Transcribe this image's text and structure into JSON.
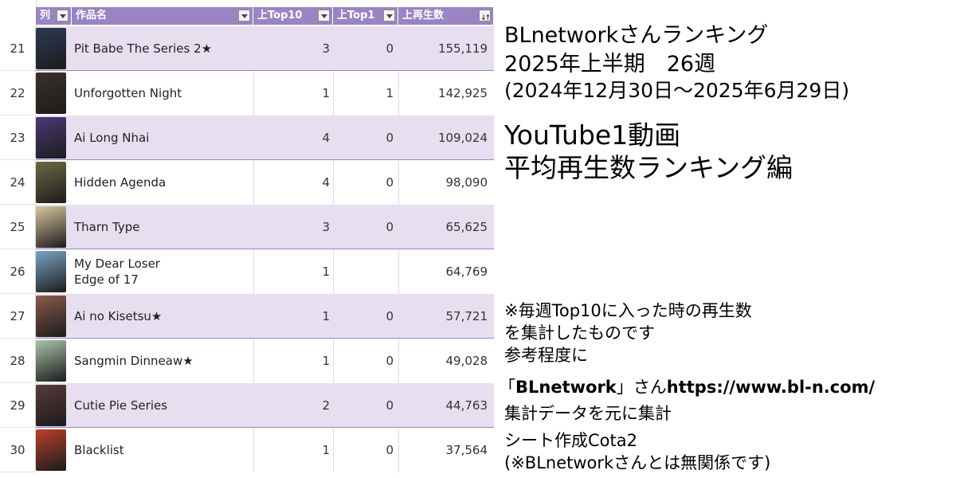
{
  "headers": {
    "col": "列",
    "title": "作品名",
    "top10": "上Top10",
    "top1": "上Top1",
    "views": "上再生数"
  },
  "rows": [
    {
      "num": "21",
      "title_lines": [
        "Pit Babe The Series 2★"
      ],
      "top10": "3",
      "top1": "0",
      "views": "155,119",
      "poster_color": "#2b3a55"
    },
    {
      "num": "22",
      "title_lines": [
        "Unforgotten Night"
      ],
      "top10": "1",
      "top1": "1",
      "views": "142,925",
      "poster_color": "#3b3028"
    },
    {
      "num": "23",
      "title_lines": [
        "Ai Long Nhai"
      ],
      "top10": "4",
      "top1": "0",
      "views": "109,024",
      "poster_color": "#4a3a78"
    },
    {
      "num": "24",
      "title_lines": [
        "Hidden Agenda"
      ],
      "top10": "4",
      "top1": "0",
      "views": "98,090",
      "poster_color": "#6b6a45"
    },
    {
      "num": "25",
      "title_lines": [
        "Tharn Type"
      ],
      "top10": "3",
      "top1": "0",
      "views": "65,625",
      "poster_color": "#d8c8a0"
    },
    {
      "num": "26",
      "title_lines": [
        "My Dear Loser",
        "Edge of 17"
      ],
      "top10": "1",
      "top1": "",
      "views": "64,769",
      "poster_color": "#7aa4c4"
    },
    {
      "num": "27",
      "title_lines": [
        "Ai no Kisetsu★"
      ],
      "top10": "1",
      "top1": "0",
      "views": "57,721",
      "poster_color": "#8a5a4a"
    },
    {
      "num": "28",
      "title_lines": [
        "Sangmin Dinneaw★"
      ],
      "top10": "1",
      "top1": "0",
      "views": "49,028",
      "poster_color": "#a8c4a8"
    },
    {
      "num": "29",
      "title_lines": [
        "Cutie Pie Series"
      ],
      "top10": "2",
      "top1": "0",
      "views": "44,763",
      "poster_color": "#5a3a3a"
    },
    {
      "num": "30",
      "title_lines": [
        "Blacklist"
      ],
      "top10": "1",
      "top1": "0",
      "views": "37,564",
      "poster_color": "#b8402a"
    }
  ],
  "info": {
    "line1": "BLnetworkさんランキング",
    "line2": "2025年上半期　26週",
    "line3": "(2024年12月30日〜2025年6月29日)",
    "line4": "YouTube1動画",
    "line5": "平均再生数ランキング編",
    "note1": "※毎週Top10に入った時の再生数",
    "note2": "を集計したものです",
    "note3": "参考程度に",
    "source_open": "「",
    "source_bold": "BLnetwork",
    "source_close": "」さん",
    "source_url": "https://www.bl-n.com/",
    "source2": "集計データを元に集計",
    "credit1": "シート作成Cota2",
    "credit2": "(※BLnetworkさんとは無関係です)"
  },
  "colors": {
    "header_bg": "#9a84c3",
    "band_bg": "#e7dff0"
  }
}
